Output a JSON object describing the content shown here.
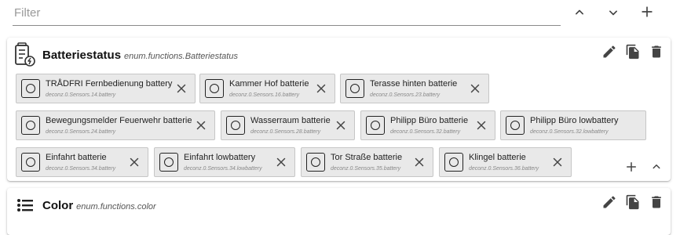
{
  "filter": {
    "placeholder": "Filter",
    "value": ""
  },
  "toolbar": {
    "collapse_all_icon": "chevron-up-icon",
    "expand_all_icon": "chevron-down-icon",
    "add_icon": "plus-icon"
  },
  "groups": [
    {
      "title": "Batteriestatus",
      "id": "enum.functions.Batteriestatus",
      "icon": "battery-status-icon",
      "members": [
        {
          "name": "TRÅDFRI Fernbedienung battery",
          "id": "deconz.0.Sensors.14.battery"
        },
        {
          "name": "Kammer Hof batterie",
          "id": "deconz.0.Sensors.16.battery"
        },
        {
          "name": "Terasse hinten batterie",
          "id": "deconz.0.Sensors.23.battery"
        },
        {
          "name": "Bewegungsmelder Feuerwehr batterie",
          "id": "deconz.0.Sensors.24.battery"
        },
        {
          "name": "Wasserraum batterie",
          "id": "deconz.0.Sensors.28.battery"
        },
        {
          "name": "Philipp Büro batterie",
          "id": "deconz.0.Sensors.32.battery"
        },
        {
          "name": "Philipp Büro lowbattery",
          "id": "deconz.0.Sensors.32.lowbattery"
        },
        {
          "name": "Einfahrt batterie",
          "id": "deconz.0.Sensors.34.battery"
        },
        {
          "name": "Einfahrt lowbattery",
          "id": "deconz.0.Sensors.34.lowbattery"
        },
        {
          "name": "Tor Straße batterie",
          "id": "deconz.0.Sensors.35.battery"
        },
        {
          "name": "Klingel batterie",
          "id": "deconz.0.Sensors.36.battery"
        }
      ]
    },
    {
      "title": "Color",
      "id": "enum.functions.color",
      "icon": "list-icon",
      "members": []
    }
  ]
}
